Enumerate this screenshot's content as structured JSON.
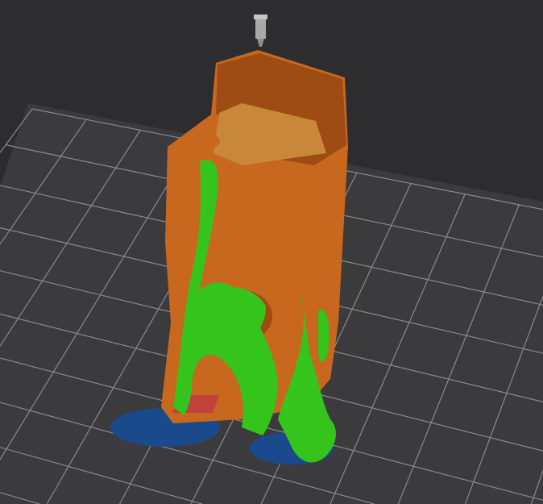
{
  "viewport": {
    "colors": {
      "background": "#2d2d30",
      "bed": "#3b3b3e",
      "grid": "#8a8a8c",
      "model": "#c8681e",
      "model_dark": "#9e4c14",
      "support": "#35c41c",
      "brim": "#1b4a8c",
      "nozzle": "#a8a8a8"
    },
    "grid_divisions": 14
  }
}
